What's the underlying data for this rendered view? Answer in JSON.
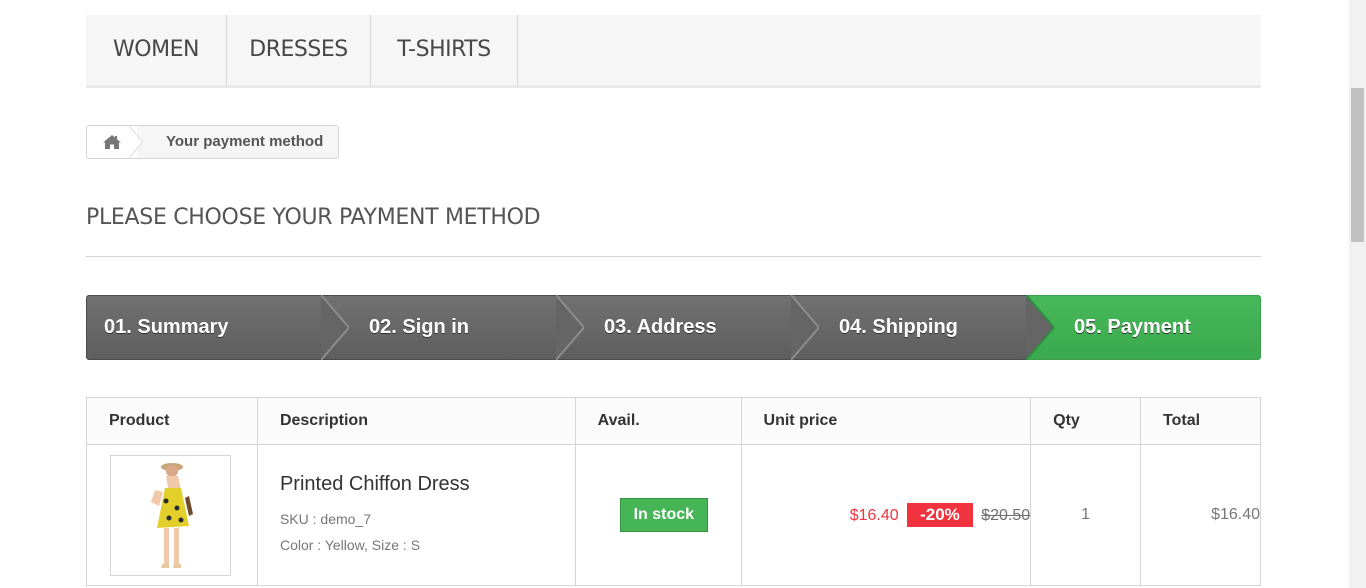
{
  "menu": {
    "items": [
      {
        "label": "WOMEN"
      },
      {
        "label": "DRESSES"
      },
      {
        "label": "T-SHIRTS"
      }
    ]
  },
  "breadcrumb": {
    "home_icon": "home-icon",
    "current": "Your payment method"
  },
  "page": {
    "heading": "PLEASE CHOOSE YOUR PAYMENT METHOD"
  },
  "steps": [
    {
      "label": "01. Summary",
      "active": false
    },
    {
      "label": "02. Sign in",
      "active": false
    },
    {
      "label": "03. Address",
      "active": false
    },
    {
      "label": "04. Shipping",
      "active": false
    },
    {
      "label": "05. Payment",
      "active": true
    }
  ],
  "cart": {
    "headers": [
      "Product",
      "Description",
      "Avail.",
      "Unit price",
      "Qty",
      "Total"
    ],
    "rows": [
      {
        "name": "Printed Chiffon Dress",
        "sku": "SKU : demo_7",
        "attributes": "Color : Yellow, Size : S",
        "availability": "In stock",
        "price": "$16.40",
        "discount": "-20%",
        "old_price": "$20.50",
        "qty": "1",
        "total": "$16.40"
      }
    ]
  },
  "colors": {
    "active_step": "#47b85a",
    "inactive_step": "#6a6a6a",
    "price_red": "#f13340",
    "stock_green": "#46b556"
  }
}
